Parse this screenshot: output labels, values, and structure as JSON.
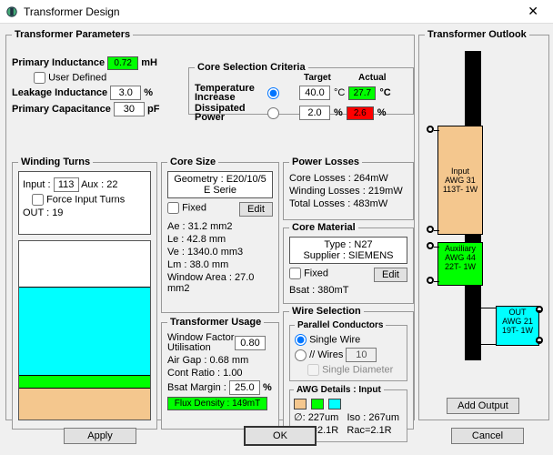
{
  "window": {
    "title": "Transformer Design"
  },
  "params": {
    "legend": "Transformer Parameters",
    "primary_inductance": {
      "label": "Primary Inductance",
      "value": "0.72",
      "unit": "mH"
    },
    "user_defined_label": "User Defined",
    "leakage": {
      "label": "Leakage Inductance",
      "value": "3.0",
      "unit": "%"
    },
    "capacitance": {
      "label": "Primary Capacitance",
      "value": "30",
      "unit": "pF"
    }
  },
  "core_sel": {
    "legend": "Core Selection Criteria",
    "target_hdr": "Target",
    "actual_hdr": "Actual",
    "temp": {
      "label": "Temperature Increase",
      "target": "40.0",
      "unit1": "°C",
      "actual": "27.7",
      "unit2": "°C"
    },
    "diss": {
      "label": "Dissipated Power",
      "target": "2.0",
      "unit1": "%",
      "actual": "2.6",
      "unit2": "%"
    }
  },
  "winding": {
    "legend": "Winding Turns",
    "input_label": "Input :",
    "input_val": "113",
    "aux": "Aux : 22",
    "force_label": "Force Input Turns",
    "out": "OUT : 19"
  },
  "coresize": {
    "legend": "Core Size",
    "geometry": "Geometry : E20/10/5",
    "serie": "E Serie",
    "fixed_label": "Fixed",
    "edit_btn": "Edit",
    "ae": "Ae : 31.2 mm2",
    "le": "Le : 42.8 mm",
    "ve": "Ve : 1340.0 mm3",
    "lm": "Lm : 38.0 mm",
    "wa": "Window Area : 27.0 mm2"
  },
  "usage": {
    "legend": "Transformer Usage",
    "wfu_label": "Window Factor Utilisation",
    "wfu_val": "0.80",
    "airgap": "Air Gap : 0.68 mm",
    "cont": "Cont Ratio : 1.00",
    "bsat_label": "Bsat Margin :",
    "bsat_val": "25.0",
    "bsat_unit": "%",
    "flux": "Flux Density : 149mT"
  },
  "losses": {
    "legend": "Power Losses",
    "core": "Core Losses : 264mW",
    "winding": "Winding Losses : 219mW",
    "total": "Total Losses : 483mW"
  },
  "material": {
    "legend": "Core Material",
    "type": "Type : N27",
    "supplier": "Supplier : SIEMENS",
    "fixed_label": "Fixed",
    "edit_btn": "Edit",
    "bsat": "Bsat : 380mT"
  },
  "wire": {
    "legend": "Wire Selection",
    "pc_legend": "Parallel Conductors",
    "single_label": "Single Wire",
    "wires_label": "// Wires",
    "wires_val": "10",
    "single_diam": "Single Diameter",
    "awg_legend": "AWG Details : Input",
    "swatches": [
      "#f4c78e",
      "#00ff00",
      "#00ffff"
    ],
    "diam": "∅: 227um",
    "iso": "Iso : 267um",
    "rdc": "Rdc=2.1R",
    "rac": "Rac=2.1R"
  },
  "outlook": {
    "legend": "Transformer Outlook",
    "input_wind": "Input\nAWG 31\n113T- 1W",
    "aux_wind": "Auxiliary\nAWG 44\n22T- 1W",
    "out_wind": "OUT\nAWG 21\n19T- 1W",
    "add_btn": "Add Output"
  },
  "buttons": {
    "apply": "Apply",
    "ok": "OK",
    "cancel": "Cancel"
  }
}
